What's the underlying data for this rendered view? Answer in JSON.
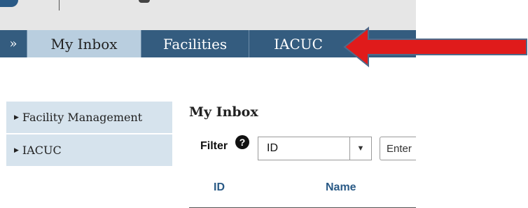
{
  "navbar": {
    "toggle_label": "»",
    "tabs": [
      {
        "label": "My Inbox",
        "active": true
      },
      {
        "label": "Facilities",
        "active": false
      },
      {
        "label": "IACUC",
        "active": false
      }
    ]
  },
  "annotation": {
    "arrow_color": "#e01b1b"
  },
  "sidebar": {
    "items": [
      {
        "label": "Facility Management"
      },
      {
        "label": "IACUC"
      }
    ]
  },
  "main": {
    "title": "My Inbox",
    "filter": {
      "label": "Filter",
      "help_icon": "question-circle-icon",
      "select_value": "ID",
      "input_placeholder": "Enter"
    },
    "table": {
      "columns": [
        "ID",
        "Name"
      ]
    }
  },
  "colors": {
    "nav_bg": "#345c7f",
    "active_tab_bg": "#b9cedf",
    "sidebar_bg": "#d6e3ed",
    "link_blue": "#2a5a86"
  }
}
